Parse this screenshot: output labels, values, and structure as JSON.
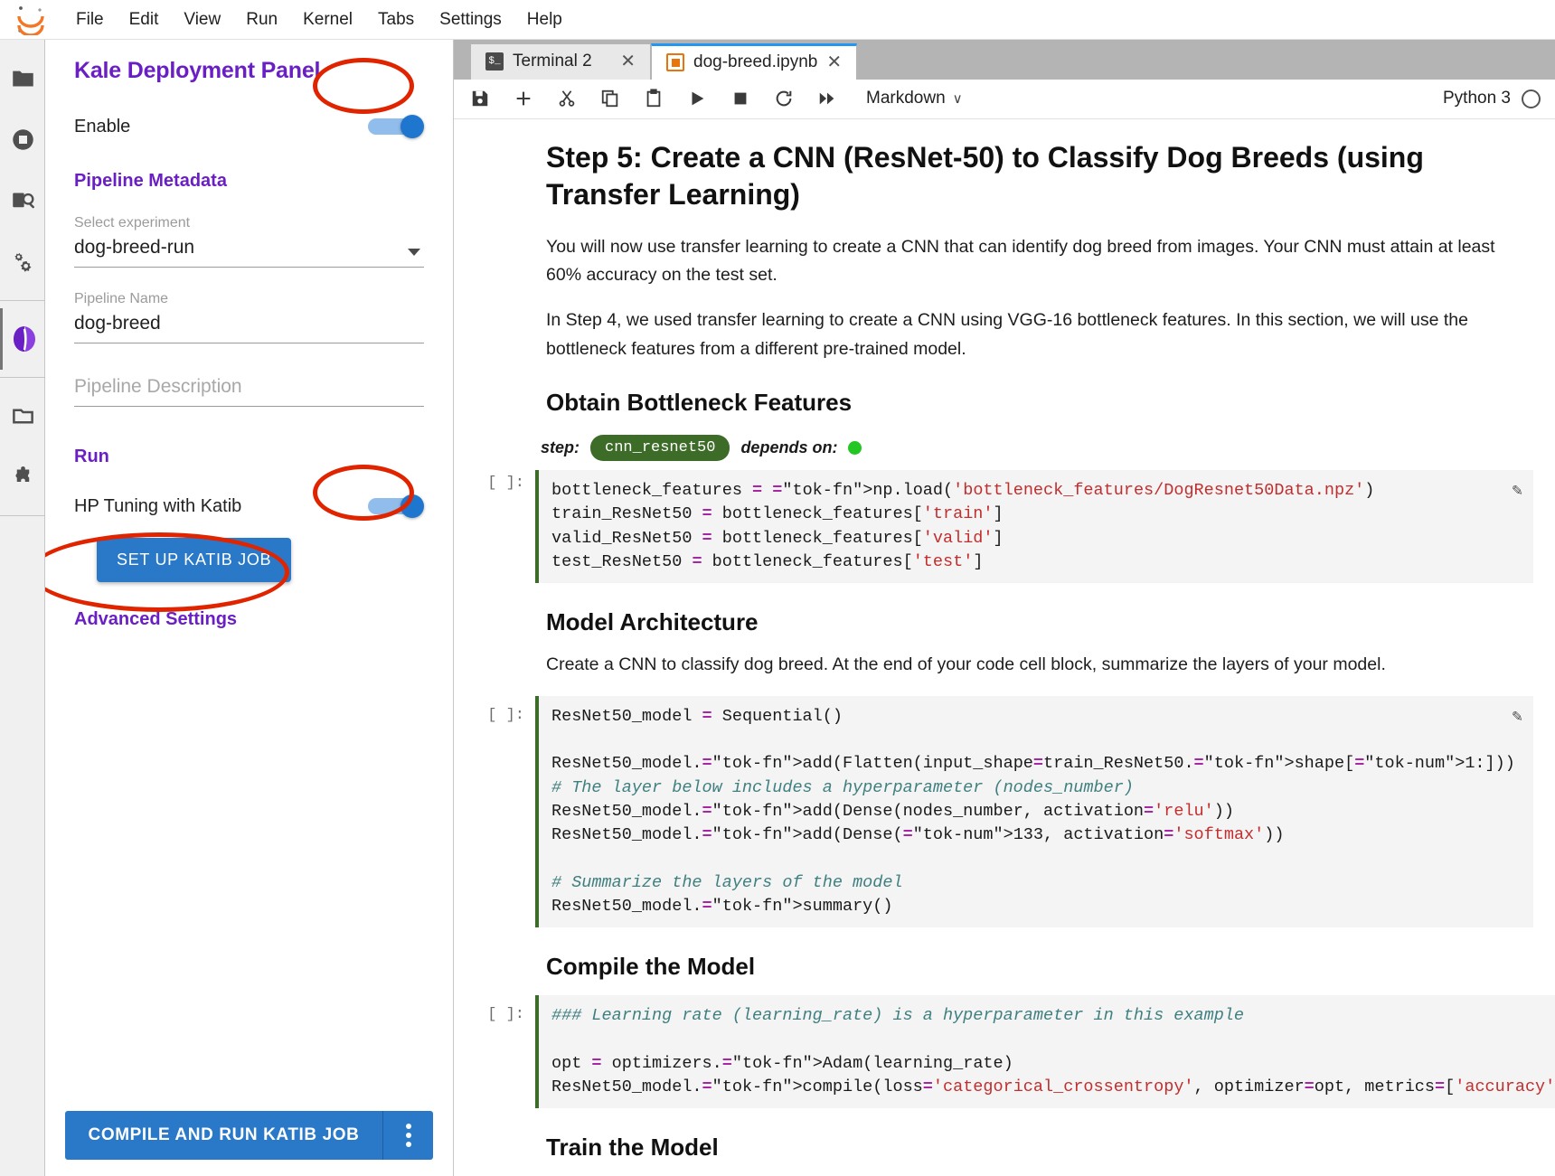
{
  "menubar": {
    "logo_name": "jupyter-logo",
    "items": [
      "File",
      "Edit",
      "View",
      "Run",
      "Kernel",
      "Tabs",
      "Settings",
      "Help"
    ]
  },
  "activitybar": {
    "items": [
      {
        "name": "file-browser-icon",
        "label": "File Browser"
      },
      {
        "name": "running-terminals-icon",
        "label": "Running Terminals and Kernels"
      },
      {
        "name": "commands-search-icon",
        "label": "Commands"
      },
      {
        "name": "property-inspector-gears-icon",
        "label": "Property Inspector"
      },
      {
        "name": "kale-logo-icon",
        "label": "Kale Deployment Panel"
      },
      {
        "name": "open-tabs-icon",
        "label": "Open Tabs"
      },
      {
        "name": "extension-manager-puzzle-icon",
        "label": "Extension Manager"
      }
    ]
  },
  "kale_panel": {
    "title": "Kale Deployment Panel",
    "enable_label": "Enable",
    "enable_on": true,
    "metadata_heading": "Pipeline Metadata",
    "experiment_label": "Select experiment",
    "experiment_value": "dog-breed-run",
    "pipeline_name_label": "Pipeline Name",
    "pipeline_name_value": "dog-breed",
    "pipeline_description_placeholder": "Pipeline Description",
    "pipeline_description_value": "",
    "run_heading": "Run",
    "katib_label": "HP Tuning with Katib",
    "katib_on": true,
    "setup_katib_button": "SET UP KATIB JOB",
    "advanced_heading": "Advanced Settings",
    "compile_button": "COMPILE AND RUN KATIB JOB",
    "more_options_icon": "kebab-menu-icon"
  },
  "tabs": [
    {
      "label": "Terminal 2",
      "icon": "terminal-icon",
      "active": false,
      "close_glyph": "✕"
    },
    {
      "label": "dog-breed.ipynb",
      "icon": "notebook-icon",
      "active": true,
      "close_glyph": "✕"
    }
  ],
  "notebook_toolbar": {
    "buttons": [
      {
        "name": "save-icon",
        "title": "Save"
      },
      {
        "name": "insert-cell-icon",
        "title": "Insert"
      },
      {
        "name": "cut-icon",
        "title": "Cut"
      },
      {
        "name": "copy-icon",
        "title": "Copy"
      },
      {
        "name": "paste-icon",
        "title": "Paste"
      },
      {
        "name": "run-icon",
        "title": "Run"
      },
      {
        "name": "stop-icon",
        "title": "Interrupt"
      },
      {
        "name": "restart-icon",
        "title": "Restart"
      },
      {
        "name": "restart-run-all-icon",
        "title": "Restart and Run All"
      }
    ],
    "cell_type": "Markdown",
    "cell_type_chevron": "∨",
    "kernel_name": "Python 3",
    "kernel_status_icon": "kernel-idle-circle-icon"
  },
  "notebook": {
    "heading_main": "Step 5: Create a CNN (ResNet-50) to Classify Dog Breeds (using Transfer Learning)",
    "para_1": "You will now use transfer learning to create a CNN that can identify dog breed from images. Your CNN must attain at least 60% accuracy on the test set.",
    "para_2": "In Step 4, we used transfer learning to create a CNN using VGG-16 bottleneck features. In this section, we will use the bottleneck features from a different pre-trained model.",
    "heading_bottleneck": "Obtain Bottleneck Features",
    "kale_step_label": "step:",
    "kale_step_name": "cnn_resnet50",
    "kale_depends_label": "depends on:",
    "prompt_empty": "[ ]:",
    "heading_architecture": "Model Architecture",
    "para_architecture": "Create a CNN to classify dog breed. At the end of your code cell block, summarize the layers of your model.",
    "heading_compile": "Compile the Model",
    "heading_train": "Train the Model",
    "edit_pencil_icon": "pencil-icon"
  },
  "code_cells": {
    "cell1": "bottleneck_features = np.load('bottleneck_features/DogResnet50Data.npz')\ntrain_ResNet50 = bottleneck_features['train']\nvalid_ResNet50 = bottleneck_features['valid']\ntest_ResNet50 = bottleneck_features['test']",
    "cell2": "ResNet50_model = Sequential()\n\nResNet50_model.add(Flatten(input_shape=train_ResNet50.shape[1:]))\n# The layer below includes a hyperparameter (nodes_number)\nResNet50_model.add(Dense(nodes_number, activation='relu'))\nResNet50_model.add(Dense(133, activation='softmax'))\n\n# Summarize the layers of the model\nResNet50_model.summary()",
    "cell3": "### Learning rate (learning_rate) is a hyperparameter in this example\n\nopt = optimizers.Adam(learning_rate)\nResNet50_model.compile(loss='categorical_crossentropy', optimizer=opt, metrics=['accuracy'])"
  },
  "colors": {
    "kale_purple": "#6a1fc4",
    "button_blue": "#2979c8",
    "toggle_blue": "#1f76cf",
    "annotation_red": "#e02400",
    "step_chip_green": "#3d6b28",
    "depends_dot_green": "#23c723"
  },
  "annotations": [
    {
      "name": "enable-toggle-highlight"
    },
    {
      "name": "katib-toggle-highlight"
    },
    {
      "name": "setup-katib-button-highlight"
    }
  ]
}
